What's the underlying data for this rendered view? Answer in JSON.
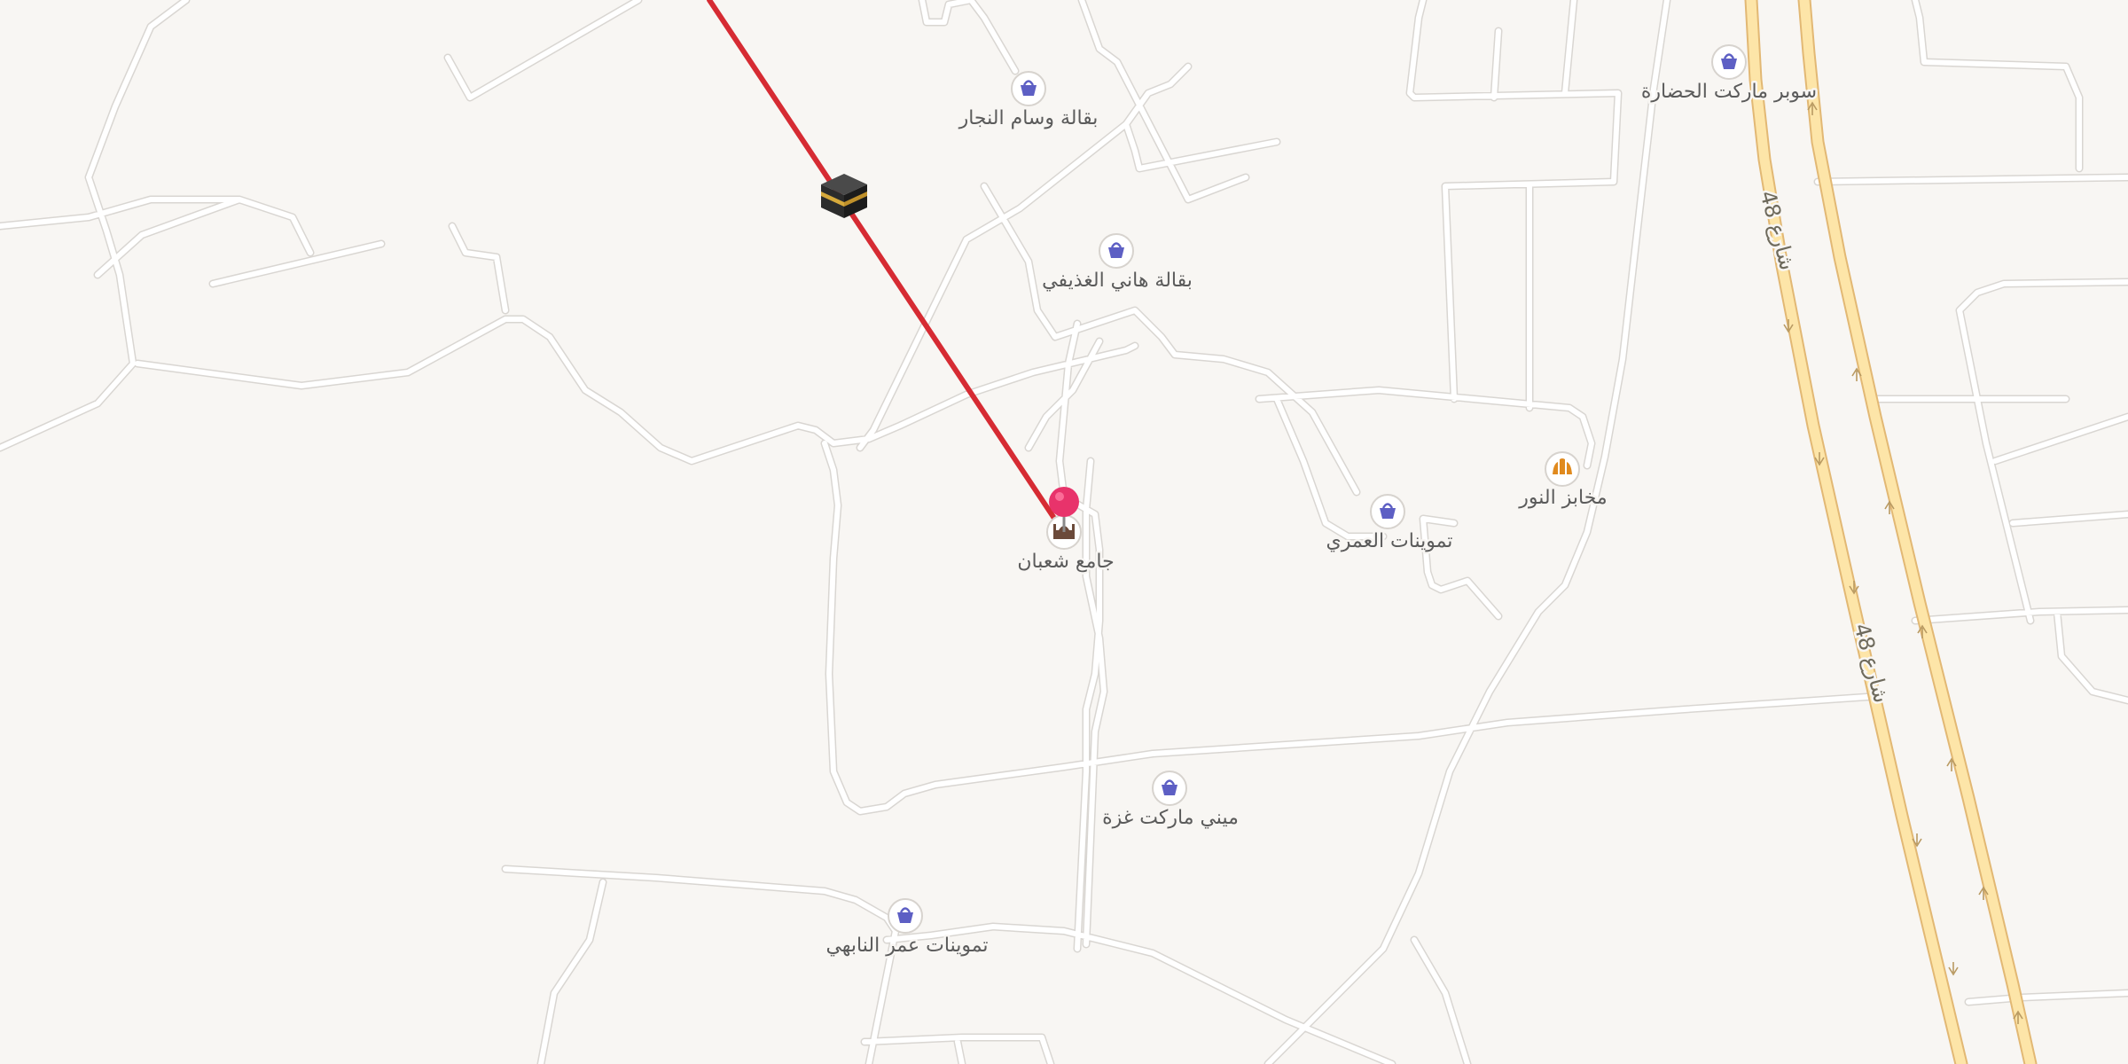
{
  "map": {
    "route_color": "#d62b33",
    "pin_color": "#e8336b",
    "poi_icon_color": "#5d5fc4",
    "highway_color": "#fde5a8"
  },
  "pois": [
    {
      "id": "wasam",
      "label": "بقالة وسام النجار",
      "icon": "shopping-basket-icon"
    },
    {
      "id": "hani",
      "label": "بقالة هاني الغذيفي",
      "icon": "shopping-basket-icon"
    },
    {
      "id": "hadara",
      "label": "سوبر ماركت الحضارة",
      "icon": "shopping-basket-icon"
    },
    {
      "id": "nour",
      "label": "مخابز النور",
      "icon": "bakery-icon"
    },
    {
      "id": "omari",
      "label": "تموينات العمري",
      "icon": "shopping-basket-icon"
    },
    {
      "id": "shaban",
      "label": "جامع شعبان",
      "icon": "mosque-icon"
    },
    {
      "id": "ghaza",
      "label": "ميني ماركت غزة",
      "icon": "shopping-basket-icon"
    },
    {
      "id": "omar",
      "label": "تموينات عمر النابهي",
      "icon": "shopping-basket-icon"
    }
  ],
  "roads": [
    {
      "id": "road48a",
      "label": "شارع 48"
    },
    {
      "id": "road48b",
      "label": "شارع 48"
    }
  ],
  "markers": {
    "kaaba": {
      "icon": "kaaba-icon"
    },
    "pin": {
      "icon": "map-pin-icon"
    }
  }
}
